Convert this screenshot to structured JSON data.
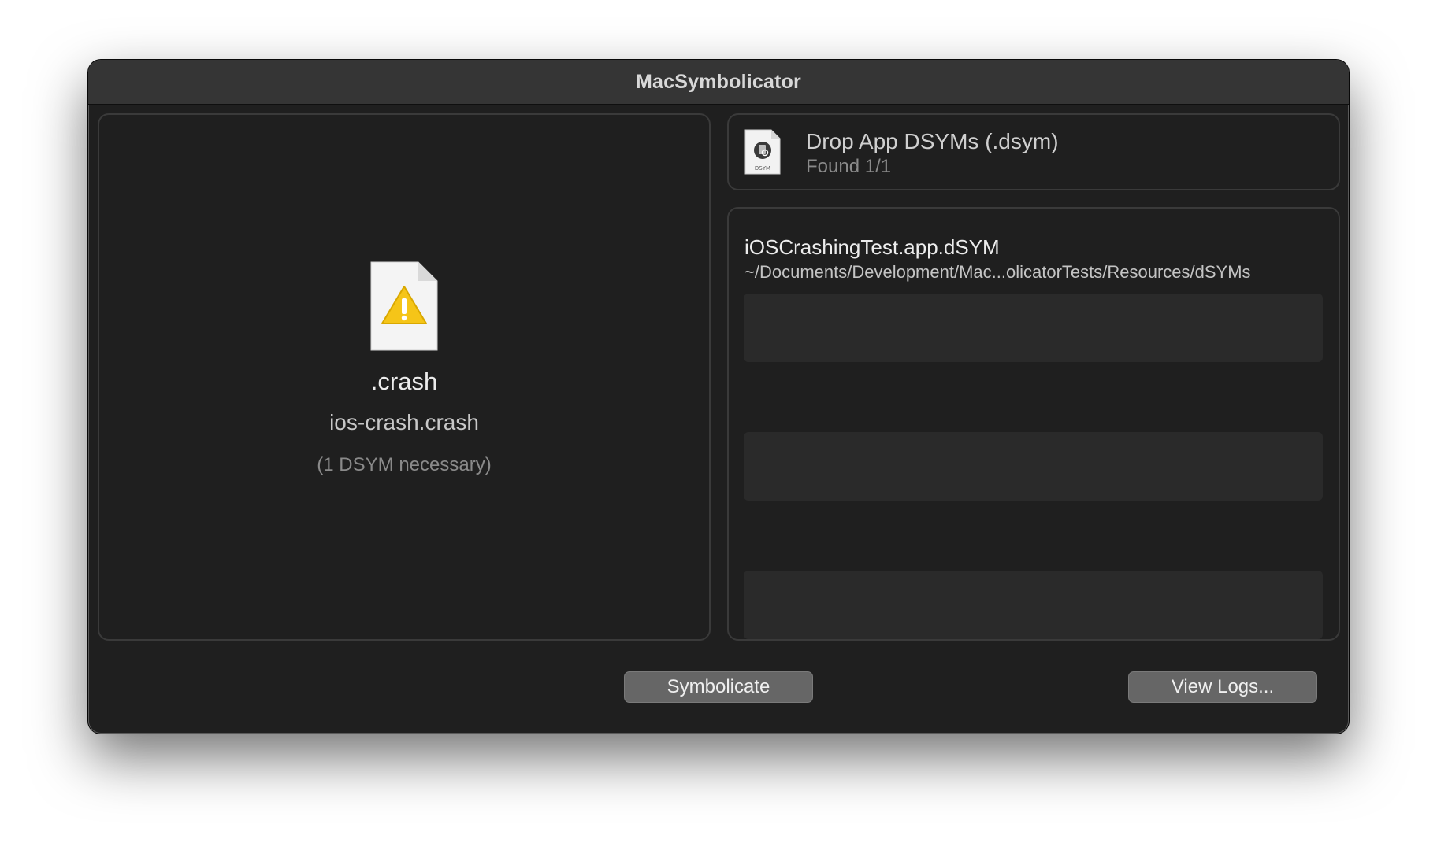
{
  "window": {
    "title": "MacSymbolicator"
  },
  "crash": {
    "extension": ".crash",
    "filename": "ios-crash.crash",
    "note": "(1 DSYM necessary)",
    "icon": "warning-document-icon"
  },
  "dsym": {
    "header_title": "Drop App DSYMs (.dsym)",
    "found": "Found 1/1",
    "icon": "dsym-document-icon",
    "items": [
      {
        "name": "iOSCrashingTest.app.dSYM",
        "path": "~/Documents/Development/Mac...olicatorTests/Resources/dSYMs"
      }
    ]
  },
  "buttons": {
    "symbolicate": "Symbolicate",
    "view_logs": "View Logs..."
  },
  "colors": {
    "window_bg": "#1f1f1f",
    "titlebar_bg": "#353535",
    "button_bg": "#666666",
    "warning_yellow": "#f5c518"
  }
}
